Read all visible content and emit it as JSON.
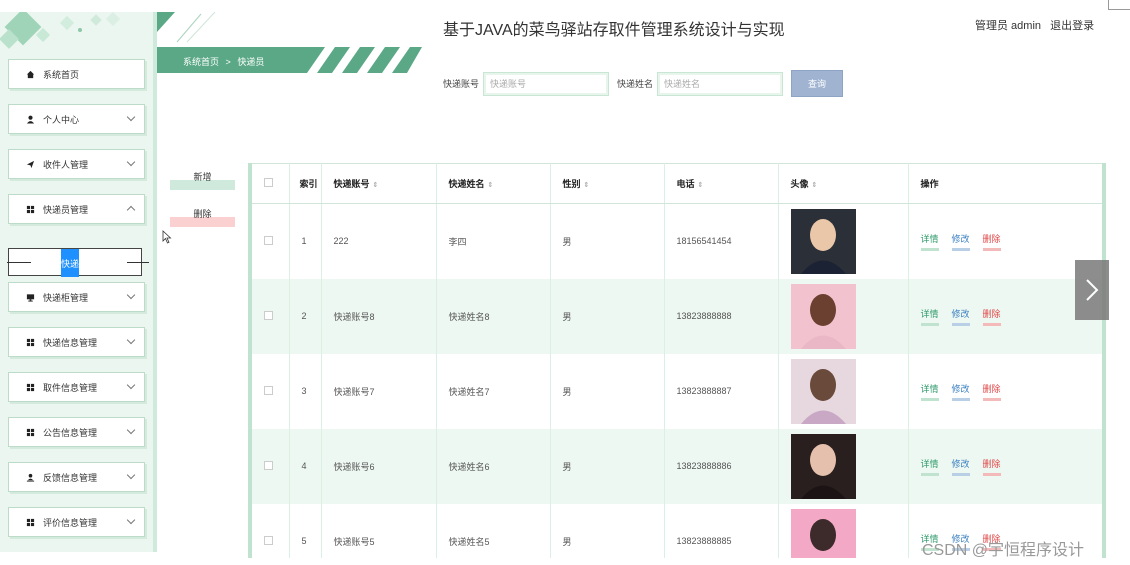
{
  "app": {
    "title": "基于JAVA的菜鸟驿站存取件管理系统设计与实现",
    "user_label": "管理员 admin",
    "logout_label": "退出登录"
  },
  "breadcrumb": {
    "home": "系统首页",
    "sep": ">",
    "current": "快递员"
  },
  "sidebar": {
    "items": [
      {
        "label": "系统首页",
        "icon": "home-icon",
        "chevron": false
      },
      {
        "label": "个人中心",
        "icon": "person-icon",
        "chevron": true
      },
      {
        "label": "收件人管理",
        "icon": "send-icon",
        "chevron": true
      },
      {
        "label": "快递员管理",
        "icon": "grid-icon",
        "chevron": true,
        "expanded": true
      },
      {
        "label": "快递柜管理",
        "icon": "monitor-icon",
        "chevron": true
      },
      {
        "label": "快递信息管理",
        "icon": "grid-icon",
        "chevron": true
      },
      {
        "label": "取件信息管理",
        "icon": "grid-icon",
        "chevron": true
      },
      {
        "label": "公告信息管理",
        "icon": "grid-icon",
        "chevron": true
      },
      {
        "label": "反馈信息管理",
        "icon": "upload-person-icon",
        "chevron": true
      },
      {
        "label": "评价信息管理",
        "icon": "grid-icon",
        "chevron": true
      }
    ],
    "sub_item": "快递员"
  },
  "search": {
    "account_label": "快递账号",
    "account_placeholder": "快递账号",
    "name_label": "快递姓名",
    "name_placeholder": "快递姓名",
    "button": "查询"
  },
  "actions": {
    "add": "新增",
    "delete": "删除"
  },
  "table": {
    "headers": {
      "index": "索引",
      "account": "快递账号",
      "name": "快递姓名",
      "gender": "性别",
      "phone": "电话",
      "avatar": "头像",
      "ops": "操作"
    },
    "op_labels": {
      "detail": "详情",
      "edit": "修改",
      "delete": "删除"
    },
    "rows": [
      {
        "index": "1",
        "account": "222",
        "name": "李四",
        "gender": "男",
        "phone": "18156541454",
        "avatar_colors": [
          "#2b2f38",
          "#e9c7a8",
          "#1a2233"
        ]
      },
      {
        "index": "2",
        "account": "快递账号8",
        "name": "快递姓名8",
        "gender": "男",
        "phone": "13823888888",
        "avatar_colors": [
          "#f2c2cf",
          "#6b4030",
          "#e9b7c6"
        ]
      },
      {
        "index": "3",
        "account": "快递账号7",
        "name": "快递姓名7",
        "gender": "男",
        "phone": "13823888887",
        "avatar_colors": [
          "#e6d8de",
          "#6a4a3a",
          "#c9a8c6"
        ]
      },
      {
        "index": "4",
        "account": "快递账号6",
        "name": "快递姓名6",
        "gender": "男",
        "phone": "13823888886",
        "avatar_colors": [
          "#2a1f1f",
          "#e4c0ad",
          "#1c1414"
        ]
      },
      {
        "index": "5",
        "account": "快递账号5",
        "name": "快递姓名5",
        "gender": "男",
        "phone": "13823888885",
        "avatar_colors": [
          "#f3a9c6",
          "#3d2a2a",
          "#f6c7d8"
        ]
      }
    ]
  },
  "watermark": "CSDN @宇恒程序设计",
  "colors": {
    "accent_green": "#5aa885",
    "sidebar_bg": "#eaf6ef",
    "selected_blue": "#1e90ff",
    "delete_red": "#e04848"
  }
}
